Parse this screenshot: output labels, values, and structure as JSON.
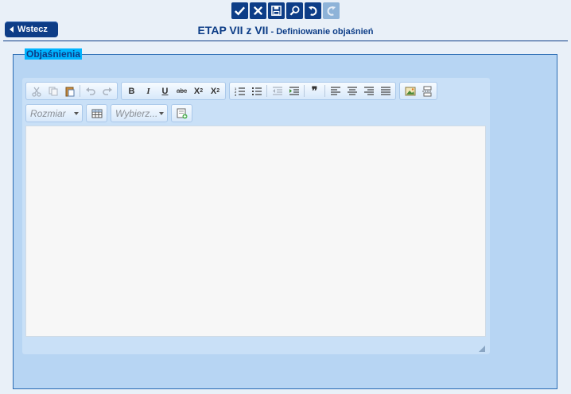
{
  "top_actions": [
    {
      "name": "confirm-icon"
    },
    {
      "name": "cancel-icon"
    },
    {
      "name": "save-icon"
    },
    {
      "name": "search-icon"
    },
    {
      "name": "undo-icon"
    },
    {
      "name": "redo-icon-disabled"
    }
  ],
  "back_button": {
    "label": "Wstecz"
  },
  "title": {
    "main": "ETAP VII z VII",
    "sub": " - Definiowanie objaśnień"
  },
  "fieldset": {
    "legend": "Objaśnienia"
  },
  "editor": {
    "toolbar": {
      "text_buttons": {
        "bold": "B",
        "italic": "I",
        "underline": "U",
        "strike": "abc",
        "subscript": "X",
        "superscript": "X",
        "blockquote": "❞"
      },
      "font_size": {
        "placeholder": "Rozmiar"
      },
      "style_select": {
        "placeholder": "Wybierz..."
      }
    },
    "content": ""
  },
  "colors": {
    "accent": "#0d3d87",
    "panel": "#b7d5f3",
    "legend_bg": "#00b4ff"
  }
}
